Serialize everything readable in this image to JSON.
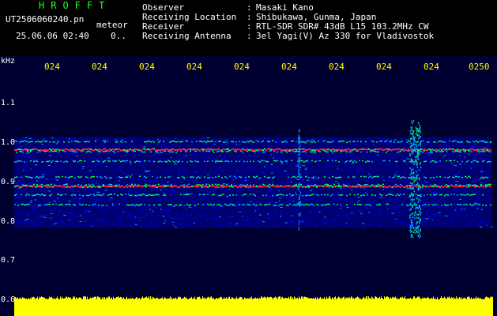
{
  "header": {
    "app_title": "HROFFT",
    "filename": "UT2506060240.pn",
    "source_type": "meteor",
    "datetime": "25.06.06 02:40",
    "counter": "0.."
  },
  "metadata": [
    {
      "key": "Observer",
      "sep": ":",
      "value": "Masaki Kano"
    },
    {
      "key": "Receiving Location",
      "sep": ":",
      "value": "Shibukawa, Gunma, Japan"
    },
    {
      "key": "Receiver",
      "sep": ":",
      "value": "RTL-SDR SDR# 43dB L15 103.2MHz CW"
    },
    {
      "key": "Receiving Antenna",
      "sep": ":",
      "value": "3el Yagi(V) Az 330 for Vladivostok"
    }
  ],
  "spectrogram": {
    "unit": "kHz",
    "y_ticks": [
      "1.1",
      "1.0",
      "0.9",
      "0.8",
      "0.7",
      "0.6"
    ],
    "x_ticks": [
      "024",
      "024",
      "024",
      "024",
      "024",
      "024",
      "024",
      "024",
      "024",
      "0250"
    ],
    "colors": {
      "background": "#000030",
      "noise_low": "#0000c0",
      "noise_mid": "#00a0ff",
      "signal": "#00ff40",
      "strong": "#ff2040",
      "level_bar": "#ffff00",
      "tick_label": "#ffff00"
    },
    "signal_band": [
      0.785,
      1.015
    ],
    "carrier_lines": [
      1.005,
      0.98,
      0.955,
      0.915,
      0.895,
      0.87,
      0.845
    ],
    "strong_lines": [
      0.985,
      0.892
    ],
    "meteor_event_minute": 8.6
  }
}
